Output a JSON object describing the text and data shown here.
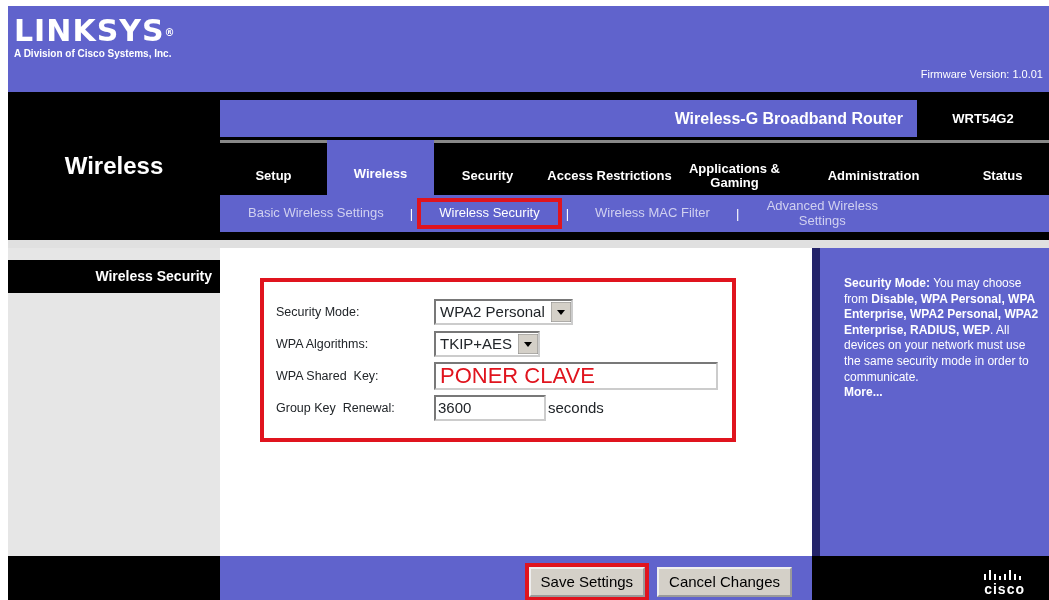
{
  "brand": {
    "logo": "LINKSYS",
    "logo_mark": "®",
    "tagline": "A Division of Cisco Systems, Inc.",
    "firmware": "Firmware Version: 1.0.01"
  },
  "section_title": "Wireless",
  "product": {
    "name": "Wireless-G Broadband Router",
    "model": "WRT54G2"
  },
  "tabs": [
    {
      "label": "Setup",
      "selected": false
    },
    {
      "label": "Wireless",
      "selected": true
    },
    {
      "label": "Security",
      "selected": false
    },
    {
      "label": "Access Restrictions",
      "selected": false
    },
    {
      "label": "Applications & Gaming",
      "selected": false
    },
    {
      "label": "Administration",
      "selected": false
    },
    {
      "label": "Status",
      "selected": false
    }
  ],
  "subtabs": [
    {
      "label": "Basic Wireless Settings",
      "selected": false,
      "highlighted": false
    },
    {
      "label": "Wireless Security",
      "selected": true,
      "highlighted": true,
      "separator": "|"
    },
    {
      "label": "Wireless MAC Filter",
      "selected": false,
      "highlighted": false,
      "separator": "|"
    },
    {
      "label": "Advanced Wireless Settings",
      "selected": false,
      "highlighted": false,
      "separator": "|"
    }
  ],
  "sidebar_heading": "Wireless Security",
  "form": {
    "highlighted": true,
    "fields": [
      {
        "kind": "select",
        "label": "Security Mode:",
        "value": "WPA2 Personal"
      },
      {
        "kind": "select",
        "label": "WPA Algorithms:",
        "value": "TKIP+AES"
      },
      {
        "kind": "key",
        "label": "WPA Shared  Key:",
        "value": "PONER CLAVE"
      },
      {
        "kind": "number",
        "label": "Group Key  Renewal:",
        "value": "3600",
        "suffix": "seconds"
      }
    ]
  },
  "help": {
    "text": "**Security Mode:** You may choose from **Disable, WPA Personal, WPA Enterprise, WPA2 Personal, WPA2 Enterprise, RADIUS, WEP**. All devices on your network must use the same security mode in order to communicate.",
    "more": "More..."
  },
  "buttons": [
    {
      "label": "Save Settings",
      "highlighted": true
    },
    {
      "label": "Cancel Changes",
      "highlighted": false
    }
  ],
  "footer_logo": "cisco"
}
